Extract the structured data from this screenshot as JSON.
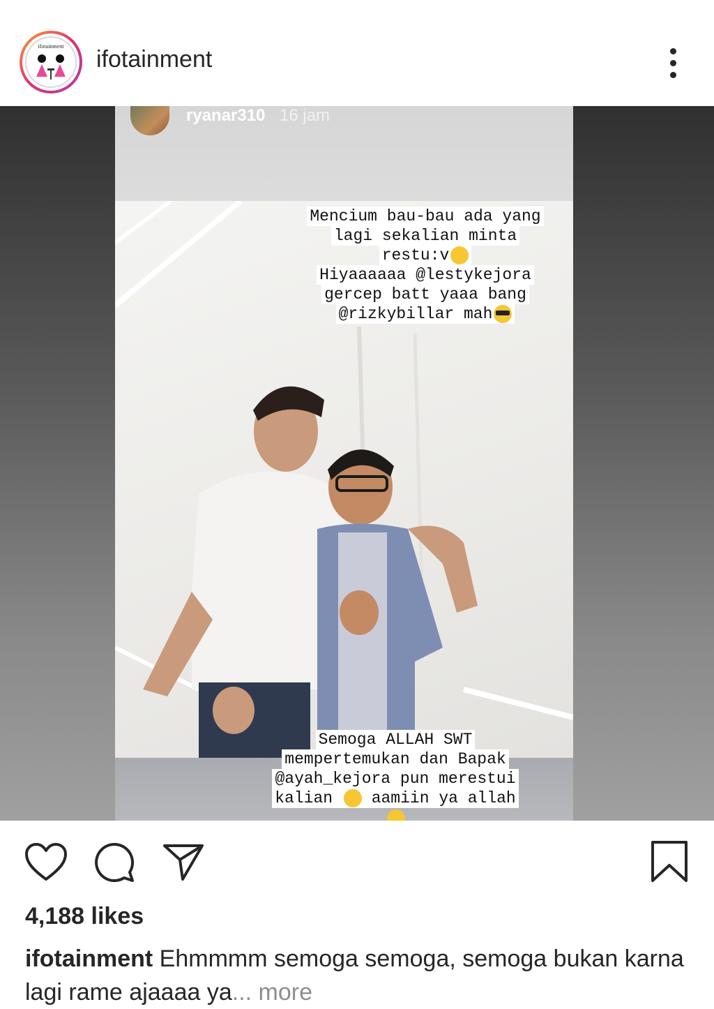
{
  "header": {
    "username": "ifotainment",
    "avatar_logo_text": "ifotainment",
    "more_icon": "more-vertical-icon"
  },
  "story": {
    "user": "ryanar310",
    "time": "16 jam",
    "top_caption_lines": [
      "Mencium bau-bau ada yang",
      "lagi sekalian minta",
      "restu:v",
      "Hiyaaaaaa @lestykejora",
      "gercep batt yaaa bang",
      "@rizkybillar mah"
    ],
    "bottom_caption_lines": [
      "Semoga ALLAH SWT",
      "mempertemukan dan Bapak",
      "@ayah_kejora pun merestui",
      "kalian",
      "aamiin ya allah"
    ]
  },
  "actions": {
    "like_icon": "heart-icon",
    "comment_icon": "comment-icon",
    "share_icon": "share-icon",
    "save_icon": "bookmark-icon"
  },
  "likes": "4,188 likes",
  "caption": {
    "username": "ifotainment",
    "text": "Ehmmmm semoga semoga, semoga bukan karna lagi rame ajaaaa ya",
    "ellipsis": "...",
    "more_label": "more"
  }
}
